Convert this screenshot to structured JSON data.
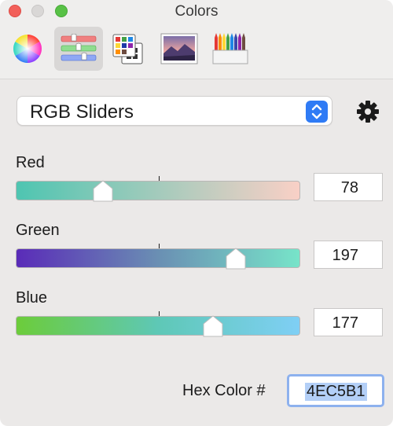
{
  "window": {
    "title": "Colors"
  },
  "toolbar": {
    "tools": [
      {
        "name": "color-wheel",
        "icon": "color-wheel-icon",
        "active": false
      },
      {
        "name": "color-sliders",
        "icon": "sliders-icon",
        "active": true
      },
      {
        "name": "color-palettes",
        "icon": "palette-grid-icon",
        "active": false
      },
      {
        "name": "image-palettes",
        "icon": "landscape-image-icon",
        "active": false
      },
      {
        "name": "pencils",
        "icon": "pencils-icon",
        "active": false
      }
    ]
  },
  "mode_select": {
    "value": "RGB Sliders",
    "icon": "up-down-chevron-icon"
  },
  "settings": {
    "icon": "gear-icon"
  },
  "sliders": {
    "red": {
      "label": "Red",
      "value": "78"
    },
    "green": {
      "label": "Green",
      "value": "197"
    },
    "blue": {
      "label": "Blue",
      "value": "177"
    }
  },
  "hex": {
    "label": "Hex Color #",
    "value": "4EC5B1"
  },
  "colors": {
    "close": "#f2605a",
    "minimize": "#d9d7d6",
    "zoom": "#58c146",
    "accent": "#2f7bf5",
    "current": "#4EC5B1"
  }
}
